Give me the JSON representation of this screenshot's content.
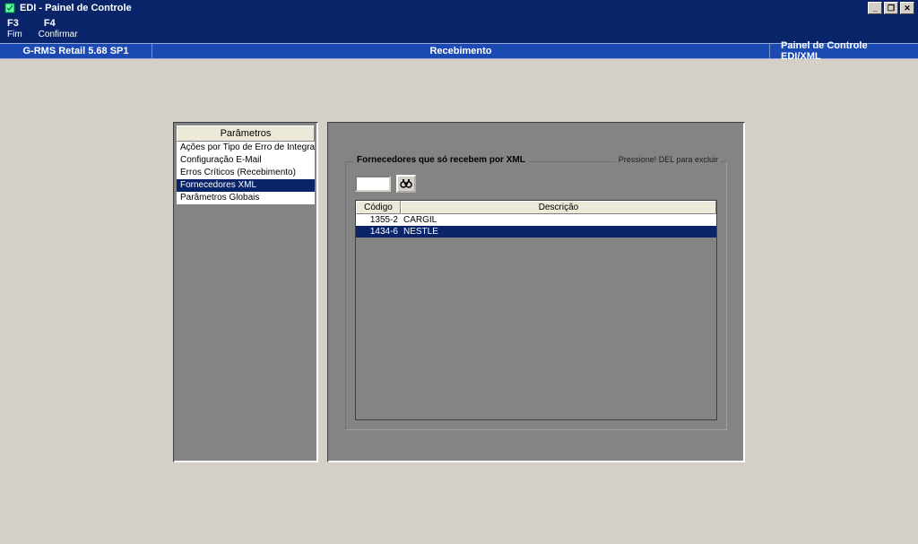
{
  "window": {
    "title": "EDI - Painel de Controle"
  },
  "menu": {
    "f3_key": "F3",
    "f4_key": "F4",
    "f3_label": "Fim",
    "f4_label": "Confirmar"
  },
  "header": {
    "left": "G-RMS Retail 5.68 SP1",
    "center": "Recebimento",
    "right": "Painel de Controle EDI/XML"
  },
  "sidebar": {
    "title": "Parâmetros",
    "items": [
      {
        "label": "Ações por Tipo de Erro de Integração XML"
      },
      {
        "label": "Configuração E-Mail"
      },
      {
        "label": "Erros Críticos (Recebimento)"
      },
      {
        "label": "Fornecedores XML"
      },
      {
        "label": "Parâmetros Globais"
      }
    ],
    "selected_index": 3
  },
  "groupbox": {
    "legend": "Fornecedores que só recebem por XML",
    "hint": "Pressione! DEL para excluir",
    "search_value": ""
  },
  "table": {
    "columns": {
      "codigo": "Código",
      "descricao": "Descrição"
    },
    "rows": [
      {
        "codigo": "1355-2",
        "descricao": "CARGIL"
      },
      {
        "codigo": "1434-6",
        "descricao": "NESTLE"
      }
    ],
    "selected_index": 1
  }
}
